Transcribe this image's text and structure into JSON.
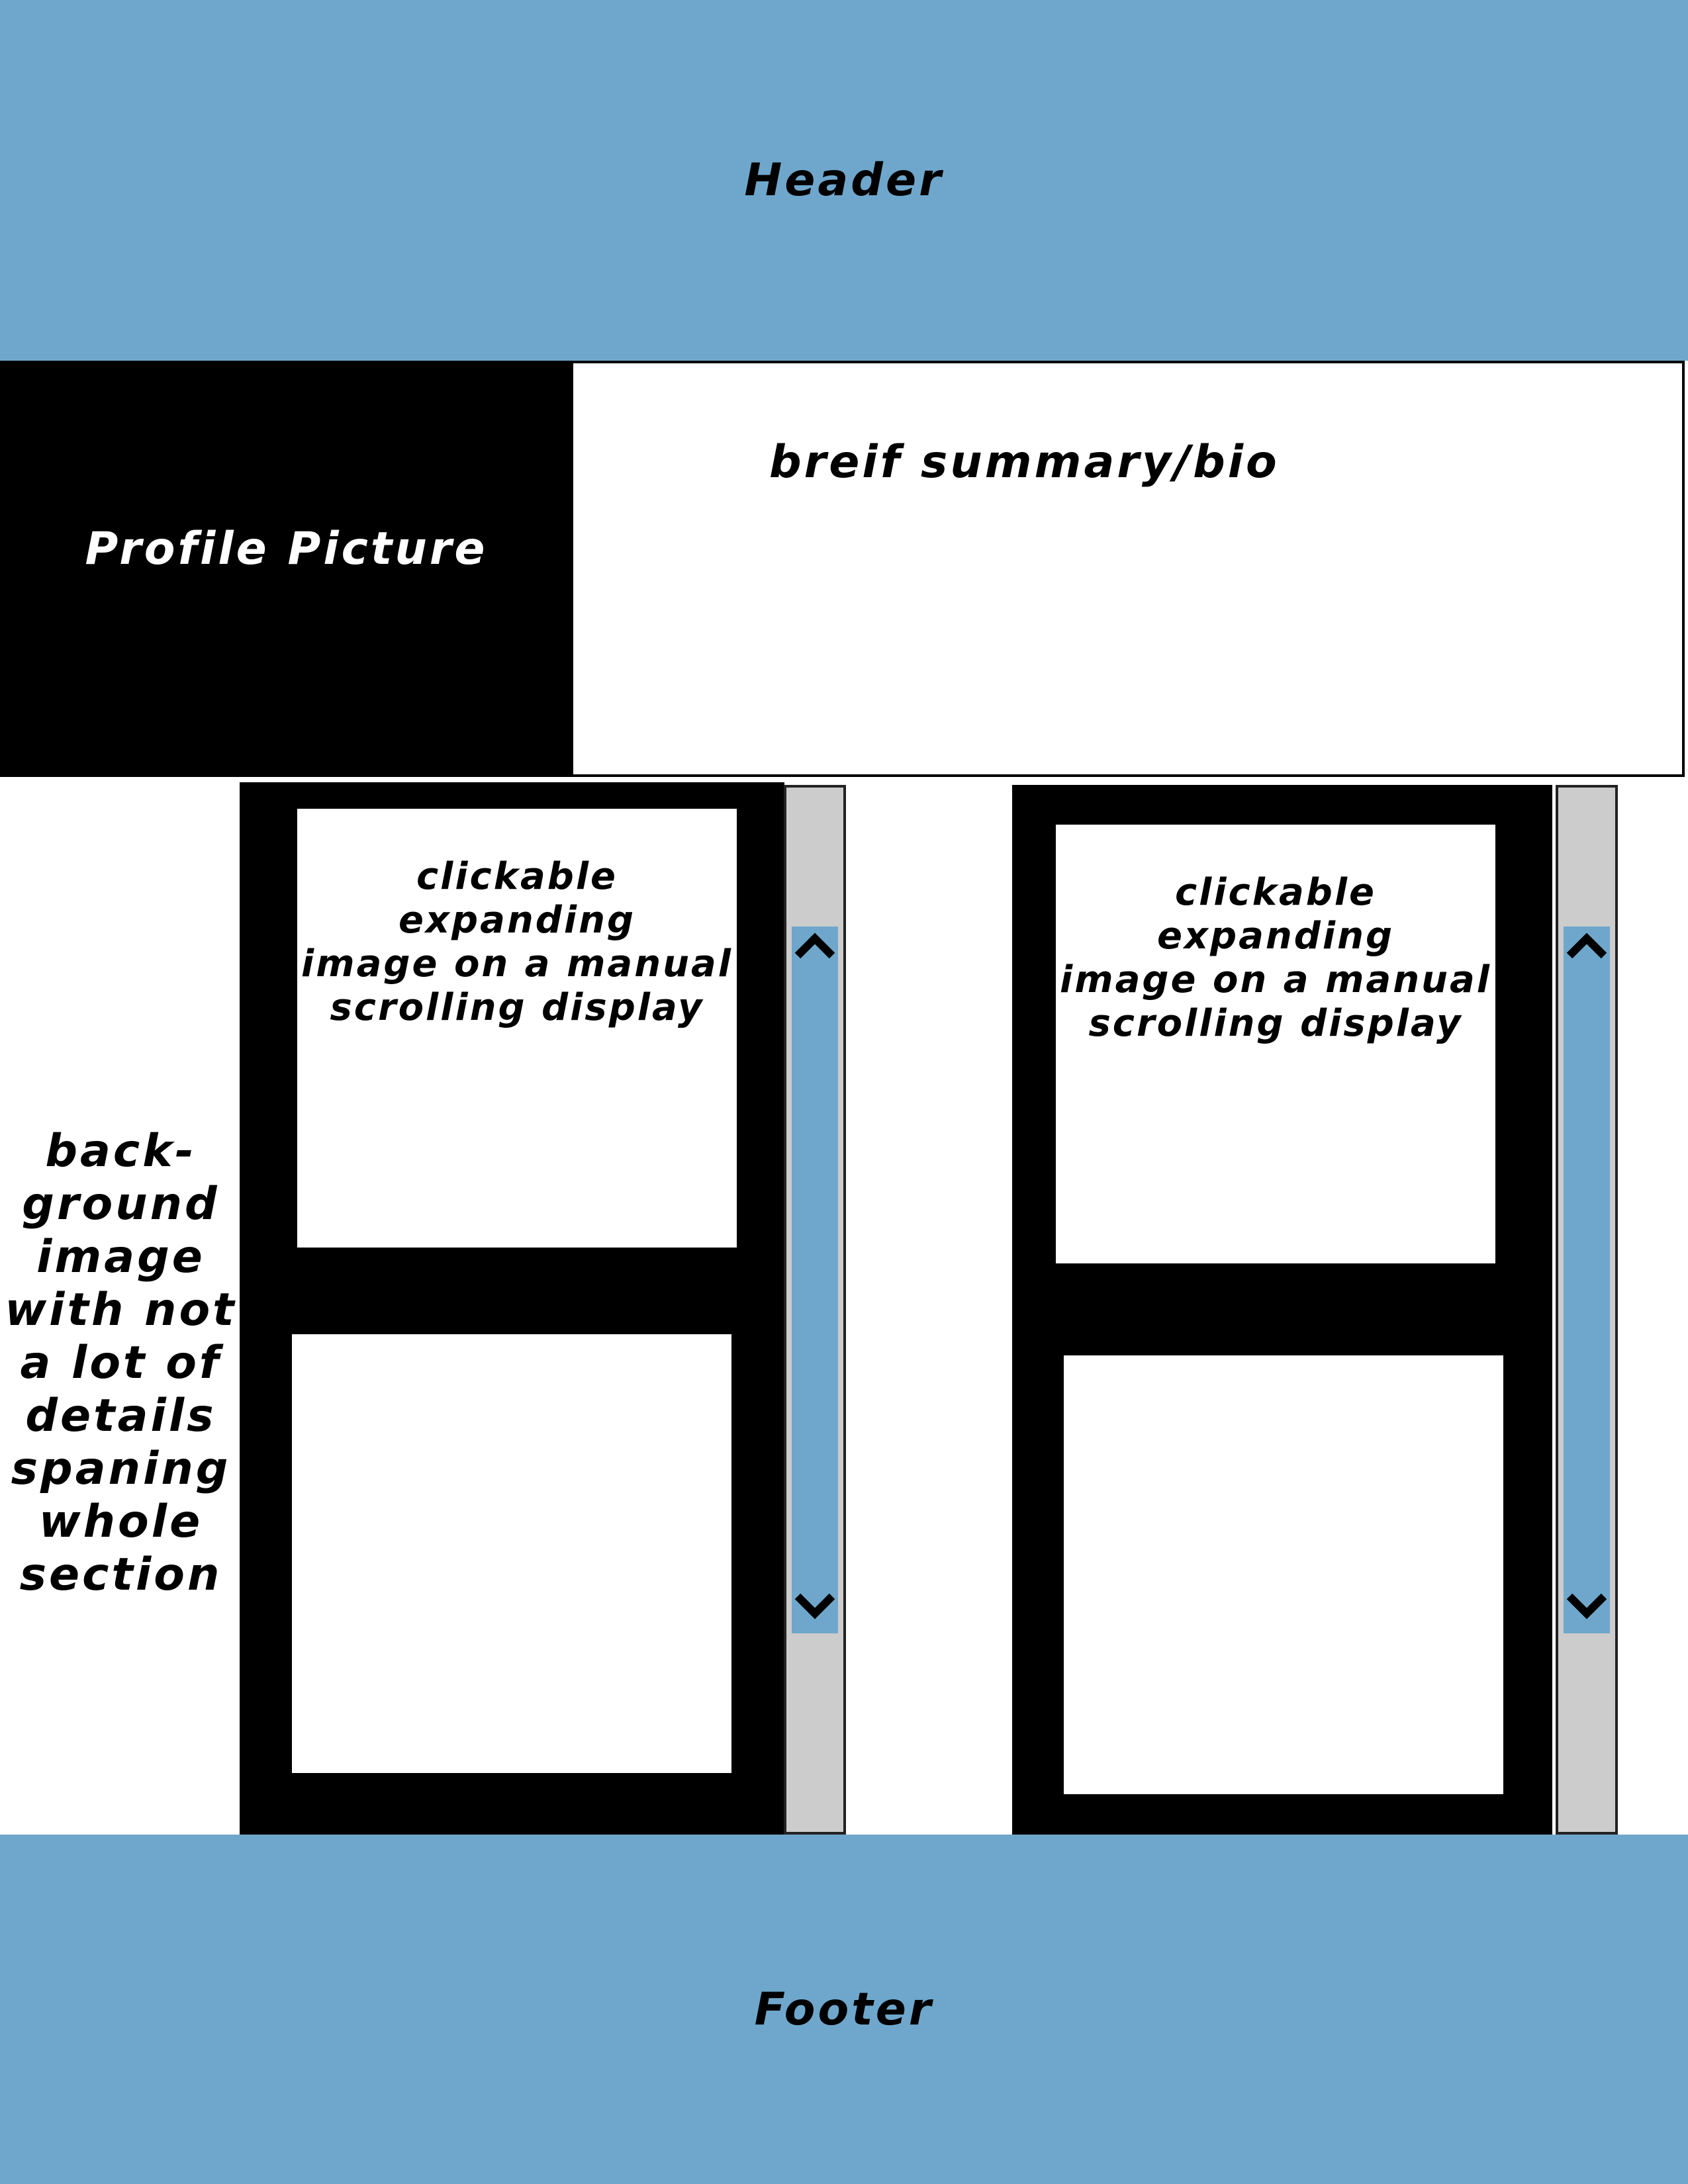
{
  "header": {
    "label": "Header"
  },
  "profile": {
    "label": "Profile Picture"
  },
  "bio": {
    "label": "breif summary/bio"
  },
  "background_note": {
    "text": "back-\nground\nimage\nwith not\na lot of\ndetails\nspaning\nwhole\nsection"
  },
  "galleries": [
    {
      "top_item_caption": "clickable expanding\nimage on a manual\nscrolling display",
      "scroll_up_icon": "chevron-up-icon",
      "scroll_down_icon": "chevron-down-icon"
    },
    {
      "top_item_caption": "clickable expanding\nimage on a manual\nscrolling display",
      "scroll_up_icon": "chevron-up-icon",
      "scroll_down_icon": "chevron-down-icon"
    }
  ],
  "footer": {
    "label": "Footer"
  },
  "colors": {
    "accent_blue": "#6fa7cc",
    "scroll_track": "#cccccc",
    "panel": "#000000"
  }
}
